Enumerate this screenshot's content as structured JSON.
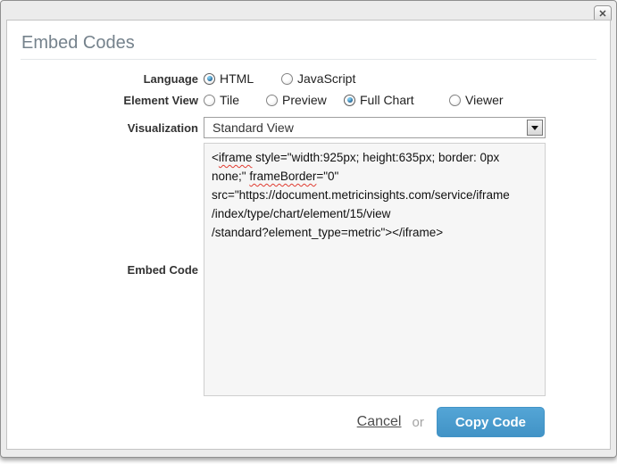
{
  "dialog": {
    "title": "Embed Codes",
    "close_icon": "✕"
  },
  "form": {
    "language": {
      "label": "Language",
      "options": [
        {
          "label": "HTML",
          "selected": true
        },
        {
          "label": "JavaScript",
          "selected": false
        }
      ]
    },
    "element_view": {
      "label": "Element View",
      "options": [
        {
          "label": "Tile",
          "selected": false
        },
        {
          "label": "Preview",
          "selected": false
        },
        {
          "label": "Full Chart",
          "selected": true
        },
        {
          "label": "Viewer",
          "selected": false
        }
      ]
    },
    "visualization": {
      "label": "Visualization",
      "selected_option": "Standard View"
    },
    "embed_code": {
      "label": "Embed Code",
      "lines": [
        {
          "segments": [
            {
              "text": "<"
            },
            {
              "text": "iframe",
              "misspelled": true
            },
            {
              "text": " style=\"width:925px; height:635px; border: 0px"
            }
          ]
        },
        {
          "segments": [
            {
              "text": "none;\" "
            },
            {
              "text": "frameBorder",
              "misspelled": true
            },
            {
              "text": "=\"0\""
            }
          ]
        },
        {
          "segments": [
            {
              "text": "src=\"https://document.metricinsights.com/service/iframe"
            }
          ]
        },
        {
          "segments": [
            {
              "text": "/index/type/chart/element/15/view"
            }
          ]
        },
        {
          "segments": [
            {
              "text": "/standard?element_type=metric\"></iframe>"
            }
          ]
        }
      ]
    }
  },
  "footer": {
    "cancel_label": "Cancel",
    "or_label": "or",
    "copy_label": "Copy Code"
  },
  "colors": {
    "accent": "#4697cb",
    "title": "#75828c",
    "misspell_underline": "#e03c31"
  }
}
